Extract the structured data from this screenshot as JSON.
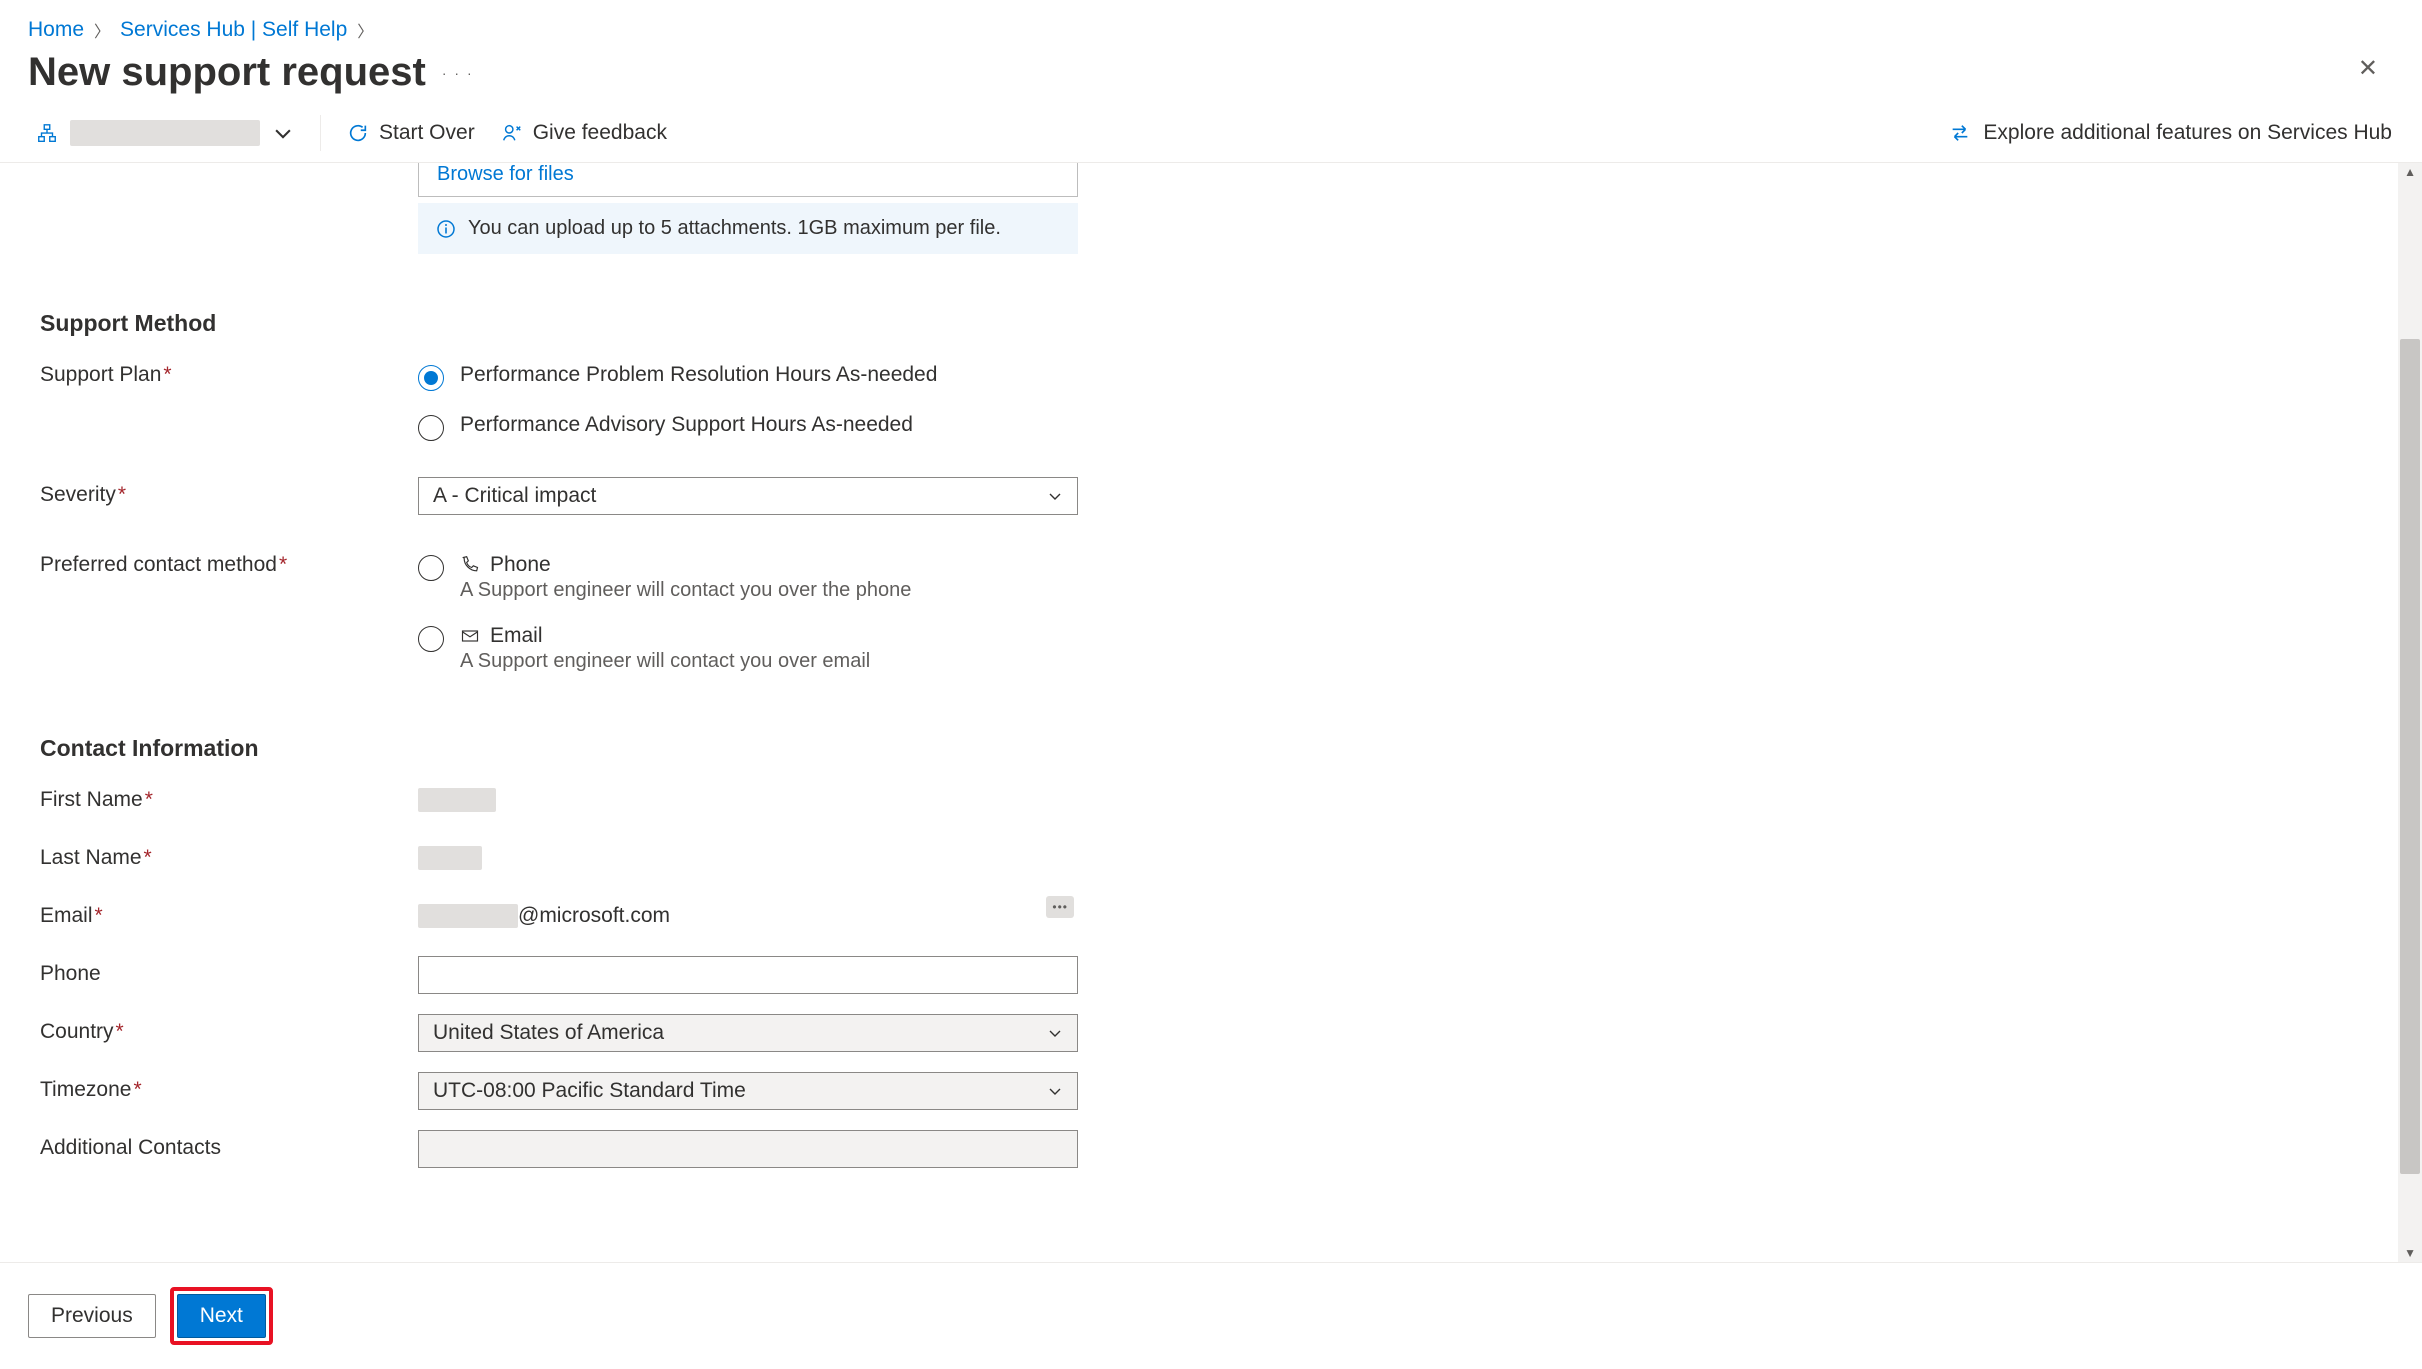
{
  "breadcrumb": {
    "home": "Home",
    "hub": "Services Hub | Self Help"
  },
  "page_title": "New support request",
  "toolbar": {
    "start_over": "Start Over",
    "give_feedback": "Give feedback",
    "explore": "Explore additional features on Services Hub"
  },
  "upload": {
    "browse": "Browse for files",
    "info": "You can upload up to 5 attachments. 1GB maximum per file."
  },
  "sections": {
    "support_method": "Support Method",
    "contact_info": "Contact Information"
  },
  "labels": {
    "support_plan": "Support Plan",
    "severity": "Severity",
    "preferred_contact": "Preferred contact method",
    "first_name": "First Name",
    "last_name": "Last Name",
    "email": "Email",
    "phone": "Phone",
    "country": "Country",
    "timezone": "Timezone",
    "additional_contacts": "Additional Contacts"
  },
  "support_plan": {
    "opt1": "Performance Problem Resolution Hours As-needed",
    "opt2": "Performance Advisory Support Hours As-needed"
  },
  "severity": {
    "selected": "A - Critical impact"
  },
  "contact_method": {
    "phone": {
      "label": "Phone",
      "desc": "A Support engineer will contact you over the phone"
    },
    "email": {
      "label": "Email",
      "desc": "A Support engineer will contact you over email"
    }
  },
  "contact": {
    "email_suffix": "@microsoft.com",
    "country": "United States of America",
    "timezone": "UTC-08:00 Pacific Standard Time"
  },
  "footer": {
    "previous": "Previous",
    "next": "Next"
  }
}
